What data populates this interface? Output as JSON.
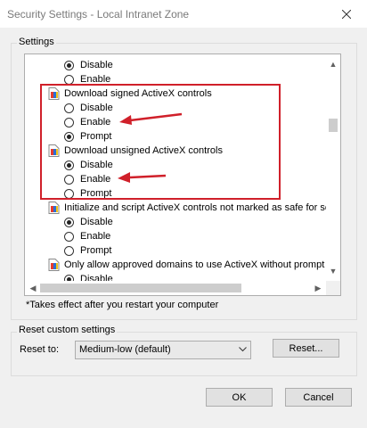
{
  "window": {
    "title": "Security Settings - Local Intranet Zone"
  },
  "settings_group": {
    "label": "Settings",
    "rows": [
      {
        "kind": "option",
        "label": "Disable",
        "checked": true
      },
      {
        "kind": "option",
        "label": "Enable",
        "checked": false
      },
      {
        "kind": "heading",
        "label": "Download signed ActiveX controls"
      },
      {
        "kind": "option",
        "label": "Disable",
        "checked": false
      },
      {
        "kind": "option",
        "label": "Enable",
        "checked": false
      },
      {
        "kind": "option",
        "label": "Prompt",
        "checked": true
      },
      {
        "kind": "heading",
        "label": "Download unsigned ActiveX controls"
      },
      {
        "kind": "option",
        "label": "Disable",
        "checked": true
      },
      {
        "kind": "option",
        "label": "Enable",
        "checked": false
      },
      {
        "kind": "option",
        "label": "Prompt",
        "checked": false
      },
      {
        "kind": "heading",
        "label": "Initialize and script ActiveX controls not marked as safe for scripting"
      },
      {
        "kind": "option",
        "label": "Disable",
        "checked": true
      },
      {
        "kind": "option",
        "label": "Enable",
        "checked": false
      },
      {
        "kind": "option",
        "label": "Prompt",
        "checked": false
      },
      {
        "kind": "heading",
        "label": "Only allow approved domains to use ActiveX without prompt"
      },
      {
        "kind": "option",
        "label": "Disable",
        "checked": true
      }
    ],
    "note": "*Takes effect after you restart your computer"
  },
  "annotation": {
    "color": "#d0202a"
  },
  "reset_group": {
    "label": "Reset custom settings",
    "reset_to_label": "Reset to:",
    "selected": "Medium-low (default)",
    "reset_button": "Reset..."
  },
  "buttons": {
    "ok": "OK",
    "cancel": "Cancel"
  }
}
